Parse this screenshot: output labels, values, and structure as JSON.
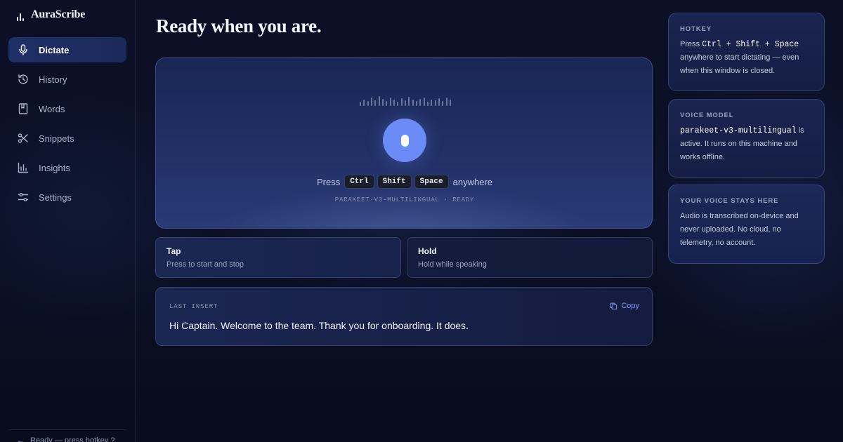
{
  "app": {
    "name": "AuraScribe"
  },
  "sidebar": {
    "items": [
      {
        "label": "Dictate",
        "icon": "mic-icon",
        "active": true
      },
      {
        "label": "History",
        "icon": "history-icon",
        "active": false
      },
      {
        "label": "Words",
        "icon": "book-icon",
        "active": false
      },
      {
        "label": "Snippets",
        "icon": "scissors-icon",
        "active": false
      },
      {
        "label": "Insights",
        "icon": "bar-chart-icon",
        "active": false
      },
      {
        "label": "Settings",
        "icon": "sliders-icon",
        "active": false
      }
    ],
    "footer_arrow": "←",
    "footer_text": "Ready — press hotkey ?"
  },
  "main": {
    "title": "Ready when you are.",
    "hero": {
      "press_prefix": "Press",
      "keys": [
        "Ctrl",
        "Shift",
        "Space"
      ],
      "press_suffix": "anywhere",
      "status": "PARAKEET-V3-MULTILINGUAL · READY"
    },
    "modes": [
      {
        "title": "Tap",
        "subtitle": "Press to start and stop"
      },
      {
        "title": "Hold",
        "subtitle": "Hold while speaking"
      }
    ],
    "last_insert": {
      "label": "LAST INSERT",
      "copy_label": "Copy",
      "text": "Hi Captain. Welcome to the team. Thank you for onboarding. It does."
    }
  },
  "info": {
    "hotkey": {
      "heading": "HOTKEY",
      "prefix": "Press",
      "combo": "Ctrl + Shift + Space",
      "body": "anywhere to start dictating — even when this window is closed."
    },
    "voice_model": {
      "heading": "VOICE MODEL",
      "model": "parakeet-v3-multilingual",
      "body": "is active. It runs on this machine and works offline."
    },
    "privacy": {
      "heading": "YOUR VOICE STAYS HERE",
      "body": "Audio is transcribed on-device and never uploaded. No cloud, no telemetry, no account."
    }
  },
  "colors": {
    "accent": "#6b8cf7",
    "background": "#0a0f22",
    "active_nav": "#1f3066"
  }
}
